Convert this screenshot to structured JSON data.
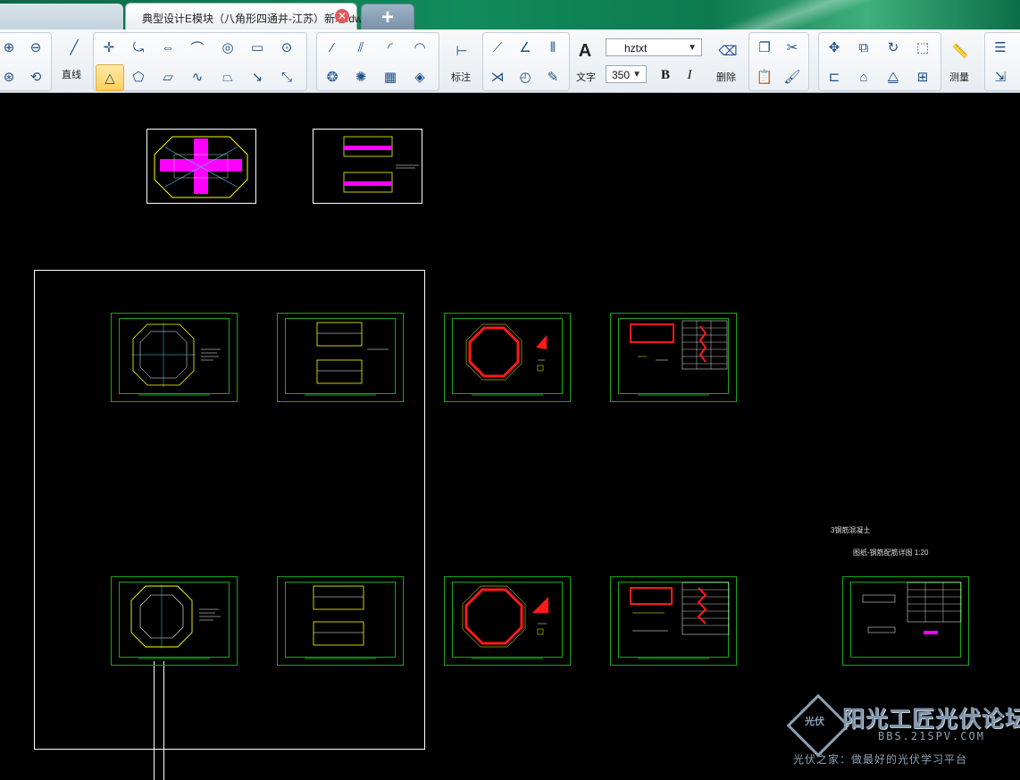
{
  "tabs": {
    "active_title": "典型设计E模块（八角形四通井-江苏）新增.dwg",
    "close_symbol": "✕",
    "new_tab_symbol": "+"
  },
  "ribbon": {
    "line_label": "直线",
    "dimension_label": "标注",
    "text_label": "文字",
    "delete_label": "删除",
    "measure_label": "测量",
    "text_style_value": "hztxt",
    "text_height_value": "350",
    "bold_label": "B",
    "italic_label": "I",
    "text_icon_glyph": "A"
  },
  "canvas": {
    "annotation_top": "3钢筋混凝土",
    "annotation_sub": "图纸-钢筋配筋详图 1:20"
  },
  "watermark": {
    "title": "阳光工匠光伏论坛",
    "url": "BBS.21SPV.COM",
    "slogan": "光伏之家：做最好的光伏学习平台",
    "logo_text": "光伏"
  },
  "colors": {
    "sheet_border": "#17a617",
    "canvas_bg": "#000000",
    "highlight_magenta": "#ff00ff",
    "red_outline": "#ff1a1a",
    "cad_yellow": "#ffff00"
  }
}
